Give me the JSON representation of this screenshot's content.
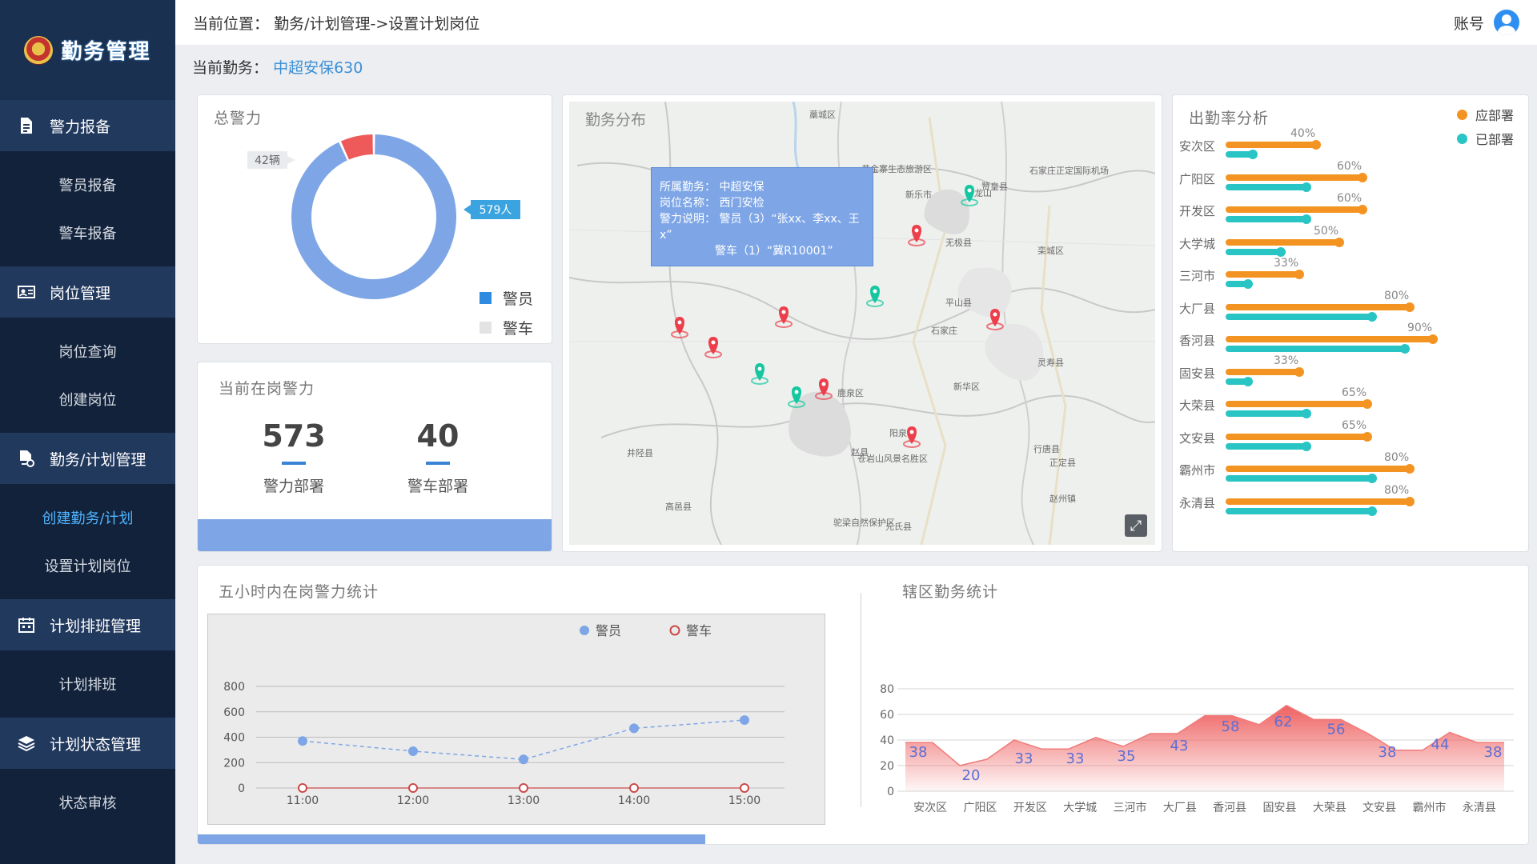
{
  "sidebar": {
    "app_title": "勤务管理",
    "groups": [
      {
        "label": "警力报备",
        "icon": "document-icon",
        "items": [
          "警员报备",
          "警车报备"
        ]
      },
      {
        "label": "岗位管理",
        "icon": "id-card-icon",
        "items": [
          "岗位查询",
          "创建岗位"
        ]
      },
      {
        "label": "勤务/计划管理",
        "icon": "file-settings-icon",
        "items": [
          "创建勤务/计划",
          "设置计划岗位"
        ]
      },
      {
        "label": "计划排班管理",
        "icon": "calendar-icon",
        "items": [
          "计划排班"
        ]
      },
      {
        "label": "计划状态管理",
        "icon": "layers-icon",
        "items": [
          "状态审核"
        ]
      }
    ],
    "active_item": "创建勤务/计划"
  },
  "topbar": {
    "crumb_label": "当前位置：",
    "crumb_path": "勤务/计划管理->设置计划岗位",
    "account_label": "账号"
  },
  "current_task": {
    "label": "当前勤务：",
    "value": "中超安保630"
  },
  "total_force": {
    "title": "总警力",
    "callout_police": "579人",
    "callout_vehicle": "42辆",
    "legend": [
      "警员",
      "警车"
    ],
    "colors": {
      "police": "#7ea6e6",
      "vehicle": "#ee5a5a"
    },
    "chart_data": {
      "type": "pie",
      "categories": [
        "警员",
        "警车"
      ],
      "values": [
        579,
        42
      ]
    }
  },
  "on_duty": {
    "title": "当前在岗警力",
    "police_value": "573",
    "police_label": "警力部署",
    "vehicle_value": "40",
    "vehicle_label": "警车部署"
  },
  "map": {
    "title": "勤务分布",
    "popup": {
      "task_label": "所属勤务：",
      "task_value": "中超安保",
      "post_label": "岗位名称：",
      "post_value": "西门安检",
      "force_label": "警力说明：",
      "force_line1": "警员（3）“张xx、李xx、王x”",
      "force_line2": "警车（1）“冀R10001”"
    },
    "place_labels": [
      "石家庄",
      "鹿泉区",
      "赵县",
      "井陉县",
      "苍岩山风景名胜区",
      "阳泉",
      "封龙山",
      "正定县",
      "藁城区",
      "栾城区",
      "平山县",
      "黄金寨生态旅游区",
      "赞皇县",
      "石家庄正定国际机场",
      "无极县",
      "新乐市",
      "灵寿县",
      "行唐县",
      "新华区",
      "高邑县",
      "赵州镇",
      "元氏县",
      "驼梁自然保护区"
    ]
  },
  "attendance": {
    "title": "出勤率分析",
    "legend": [
      "应部署",
      "已部署"
    ],
    "colors": {
      "should": "#f39422",
      "actual": "#29c4c4"
    },
    "rows": [
      {
        "name": "安次区",
        "pct": "40%",
        "should": 0.4,
        "actual": 0.13
      },
      {
        "name": "广阳区",
        "pct": "60%",
        "should": 0.6,
        "actual": 0.36
      },
      {
        "name": "开发区",
        "pct": "60%",
        "should": 0.6,
        "actual": 0.36
      },
      {
        "name": "大学城",
        "pct": "50%",
        "should": 0.5,
        "actual": 0.25
      },
      {
        "name": "三河市",
        "pct": "33%",
        "should": 0.33,
        "actual": 0.11
      },
      {
        "name": "大厂县",
        "pct": "80%",
        "should": 0.8,
        "actual": 0.64
      },
      {
        "name": "香河县",
        "pct": "90%",
        "should": 0.9,
        "actual": 0.78
      },
      {
        "name": "固安县",
        "pct": "33%",
        "should": 0.33,
        "actual": 0.11
      },
      {
        "name": "大荣县",
        "pct": "65%",
        "should": 0.62,
        "actual": 0.36
      },
      {
        "name": "文安县",
        "pct": "65%",
        "should": 0.62,
        "actual": 0.36
      },
      {
        "name": "霸州市",
        "pct": "80%",
        "should": 0.8,
        "actual": 0.64
      },
      {
        "name": "永清县",
        "pct": "80%",
        "should": 0.8,
        "actual": 0.64
      }
    ]
  },
  "five_hour": {
    "title": "五小时内在岗警力统计",
    "legend": [
      "警员",
      "警车"
    ],
    "chart_data": {
      "type": "line",
      "x": [
        "11:00",
        "12:00",
        "13:00",
        "14:00",
        "15:00"
      ],
      "ylim": [
        0,
        800
      ],
      "yticks": [
        0,
        200,
        400,
        600,
        800
      ],
      "series": [
        {
          "name": "警员",
          "values": [
            370,
            290,
            225,
            470,
            535
          ],
          "color": "#7ea6e6"
        },
        {
          "name": "警车",
          "values": [
            0,
            0,
            0,
            0,
            0
          ],
          "color": "#c94a4a"
        }
      ]
    }
  },
  "district": {
    "title": "辖区勤务统计",
    "chart_data": {
      "type": "area",
      "categories": [
        "安次区",
        "广阳区",
        "开发区",
        "大学城",
        "三河市",
        "大厂县",
        "香河县",
        "固安县",
        "大荣县",
        "文安县",
        "霸州市",
        "永清县"
      ],
      "ylim": [
        0,
        80
      ],
      "yticks": [
        0,
        20,
        40,
        60,
        80
      ],
      "labels": [
        "38",
        "20",
        "33",
        "33",
        "35",
        "43",
        "58",
        "62",
        "56",
        "38",
        "44",
        "38"
      ],
      "values": [
        38,
        38,
        20,
        25,
        40,
        33,
        33,
        42,
        35,
        45,
        45,
        59,
        59,
        52,
        67,
        56,
        56,
        45,
        32,
        32,
        46,
        38,
        38
      ]
    }
  }
}
